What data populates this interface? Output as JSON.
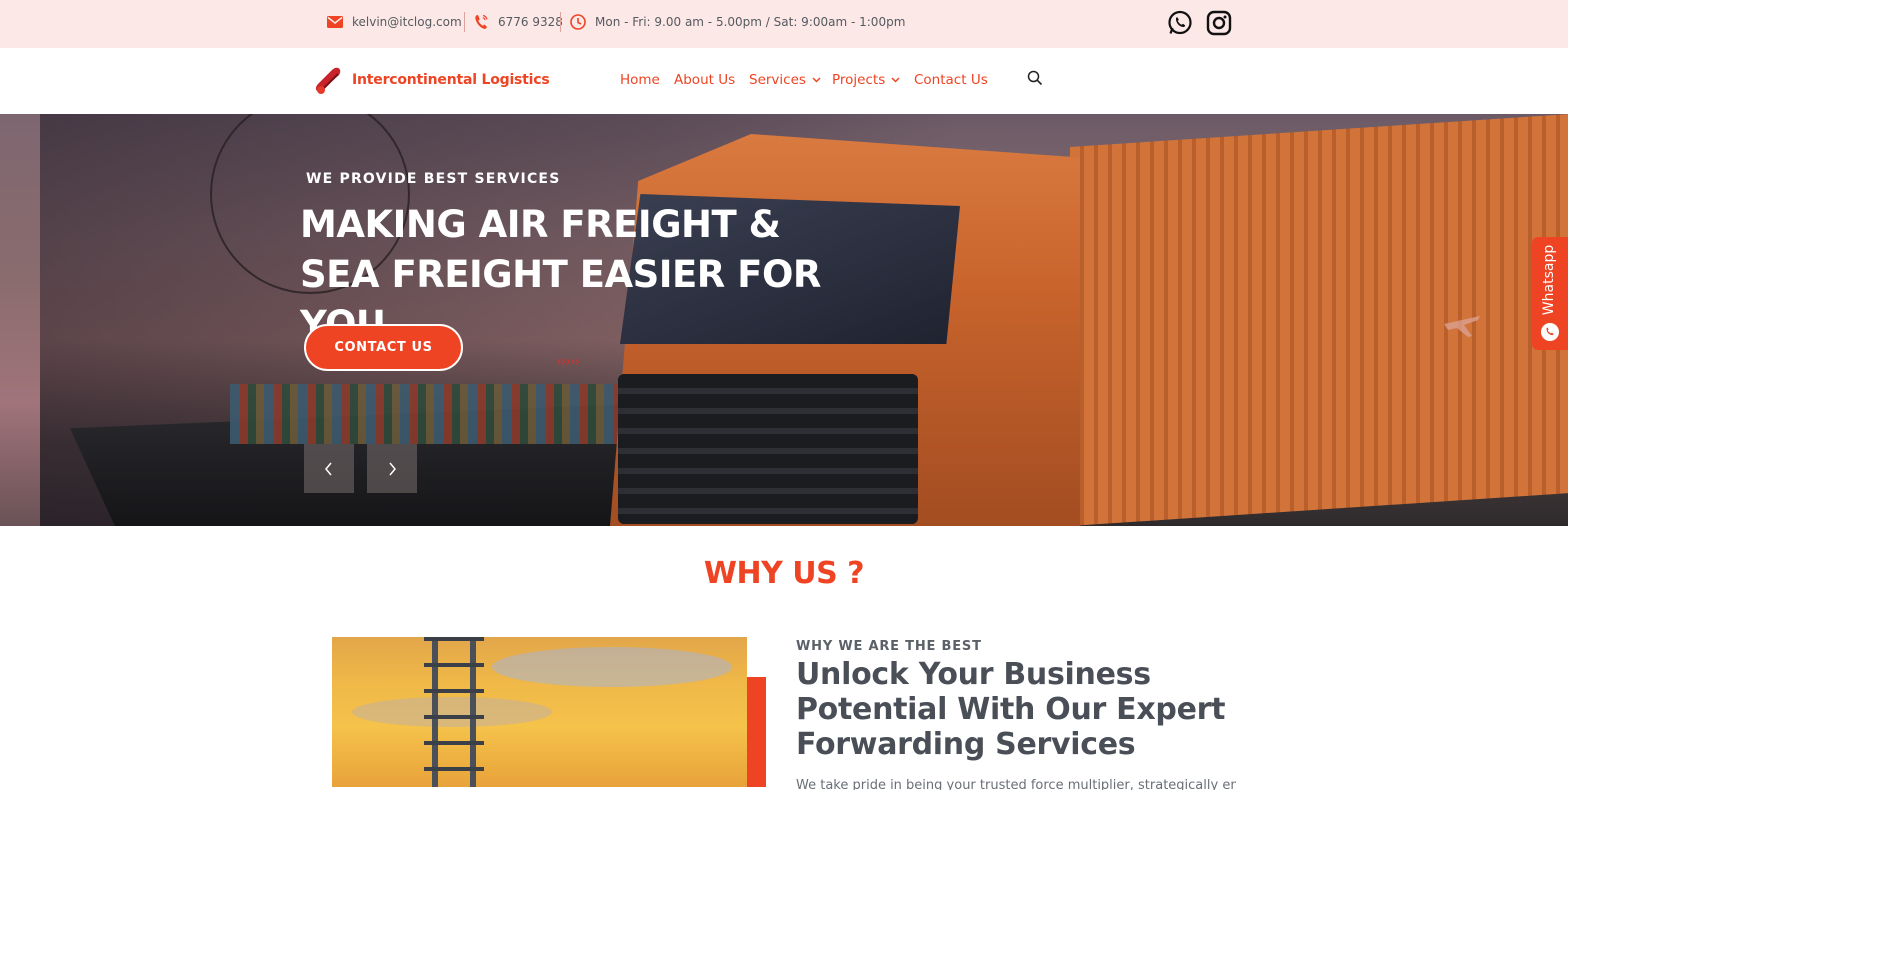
{
  "topbar": {
    "email": "kelvin@itclog.com",
    "phone": "6776 9328",
    "hours": "Mon - Fri: 9.00 am - 5.00pm / Sat: 9:00am - 1:00pm",
    "icons": [
      "envelope-icon",
      "phone-icon",
      "clock-icon",
      "whatsapp-icon",
      "instagram-icon"
    ]
  },
  "header": {
    "logo_text": "Intercontinental Logistics",
    "nav": [
      {
        "label": "Home"
      },
      {
        "label": "About Us"
      },
      {
        "label": "Services",
        "has_dropdown": true
      },
      {
        "label": "Projects",
        "has_dropdown": true
      },
      {
        "label": "Contact Us"
      }
    ]
  },
  "hero": {
    "subtitle": "WE PROVIDE BEST SERVICES",
    "title": "MAKING AIR FREIGHT & SEA FREIGHT EASIER FOR YOU",
    "cta": "CONTACT US",
    "arrows": "›››››"
  },
  "floating": {
    "whatsapp_label": "Whatsapp"
  },
  "why_us": {
    "title": "WHY US ?",
    "kicker": "WHY WE ARE THE BEST",
    "heading": "Unlock Your Business Potential With Our Expert Forwarding Services",
    "body": "We take pride in being your trusted force multiplier, strategically enabling"
  },
  "colors": {
    "accent": "#ee4423",
    "topbar_bg": "#fde8e8",
    "heading_gray": "#4a4f57"
  }
}
